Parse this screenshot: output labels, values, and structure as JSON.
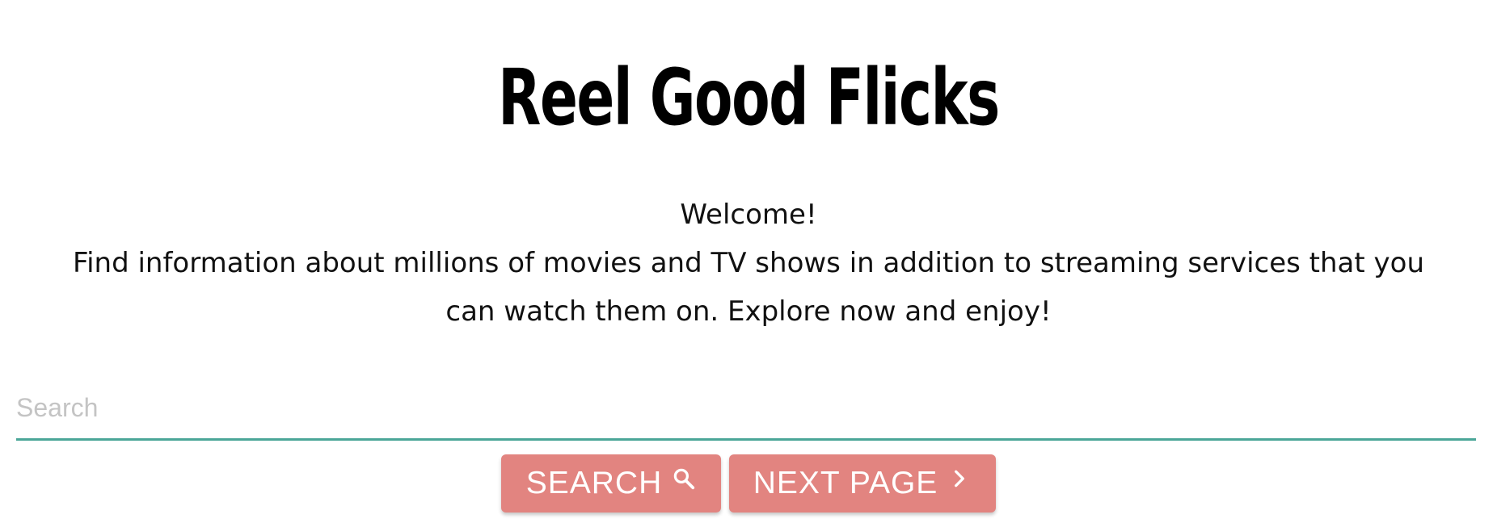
{
  "header": {
    "title": "Reel Good Flicks"
  },
  "intro": {
    "welcome": "Welcome!",
    "description": "Find information about millions of movies and TV shows in addition to streaming services that you can watch them on. Explore now and enjoy!"
  },
  "search": {
    "value": "",
    "placeholder": "Search"
  },
  "actions": {
    "search_label": "SEARCH",
    "search_icon": "search-icon",
    "next_label": "NEXT PAGE",
    "next_icon": "chevron-right-icon"
  },
  "colors": {
    "button_background": "#e28480",
    "button_text": "#ffffff",
    "search_underline": "#4aa698",
    "placeholder_text": "#c4c4c4",
    "title_text": "#000000"
  }
}
